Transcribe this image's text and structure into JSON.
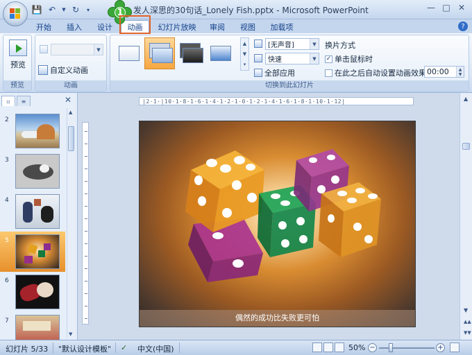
{
  "window": {
    "title": "发人深思的30句话_Lonely Fish.pptx - Microsoft PowerPoint",
    "callout_number": "1"
  },
  "tabs": [
    {
      "label": "开始"
    },
    {
      "label": "插入"
    },
    {
      "label": "设计"
    },
    {
      "label": "动画"
    },
    {
      "label": "幻灯片放映"
    },
    {
      "label": "审阅"
    },
    {
      "label": "视图"
    },
    {
      "label": "加载项"
    }
  ],
  "active_tab": "动画",
  "ribbon": {
    "preview_group": {
      "button_label": "预览",
      "group_label": "预览"
    },
    "animation_group": {
      "custom_animation_label": "自定义动画",
      "group_label": "动画"
    },
    "transition_group": {
      "group_label": "切换到此幻灯片",
      "sound_value": "[无声音]",
      "speed_value": "快速",
      "apply_all_label": "全部应用"
    },
    "advance_slide": {
      "heading": "换片方式",
      "on_click_label": "单击鼠标时",
      "on_click_checked": true,
      "auto_label": "在此之后自动设置动画效果:",
      "auto_checked": false,
      "auto_time": "00:00"
    }
  },
  "slide_pane": {
    "slides": [
      {
        "number": "2"
      },
      {
        "number": "3"
      },
      {
        "number": "4"
      },
      {
        "number": "5"
      },
      {
        "number": "6"
      },
      {
        "number": "7"
      }
    ],
    "selected_slide": "5"
  },
  "ruler_text": "|2·1·|10·1·8·1·6·1·4·1·2·1·0·1·2·1·4·1·6·1·8·1·10·1·12|",
  "current_slide": {
    "caption": "偶然的成功比失败更可怕"
  },
  "status_bar": {
    "slide_info": "幻灯片 5/33",
    "theme": "\"默认设计模板\"",
    "language": "中文(中国)",
    "zoom": "50%"
  },
  "colors": {
    "accent_orange": "#e2622a",
    "ribbon_text": "#15428b",
    "selected_thumb": "#f6a742"
  }
}
